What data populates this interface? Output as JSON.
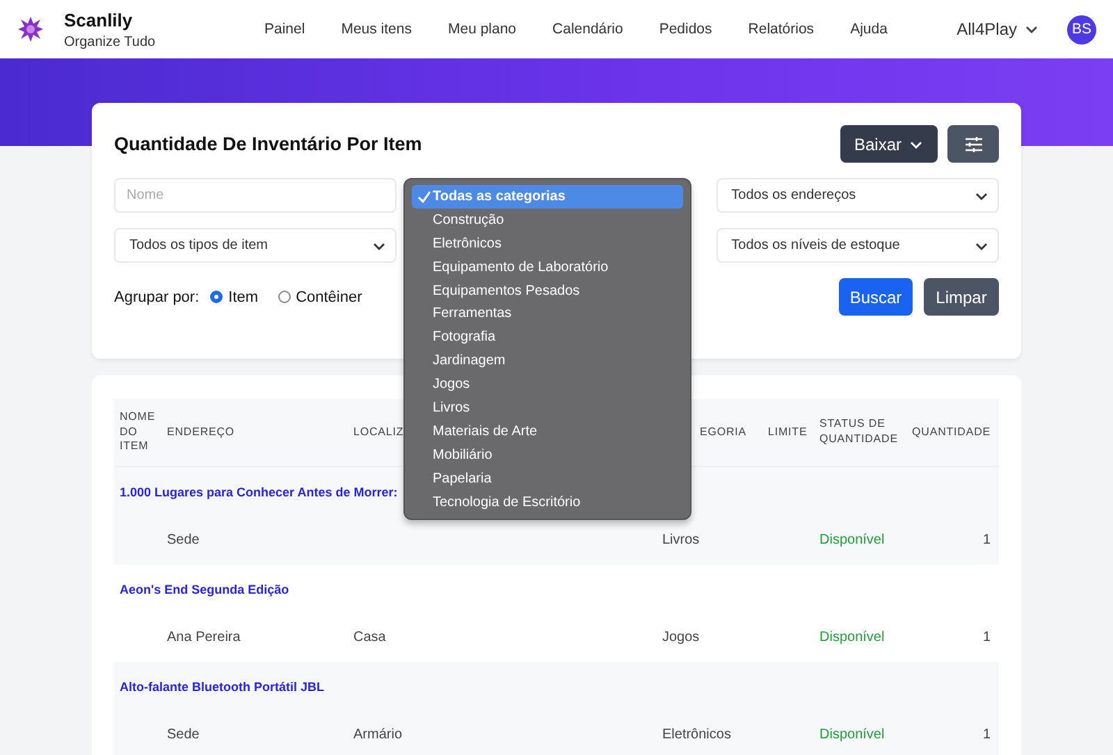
{
  "topbar": {
    "brand": "Scanlily",
    "tagline": "Organize Tudo",
    "nav": [
      {
        "label": "Painel"
      },
      {
        "label": "Meus itens"
      },
      {
        "label": "Meu plano"
      },
      {
        "label": "Calendário"
      },
      {
        "label": "Pedidos"
      },
      {
        "label": "Relatórios"
      },
      {
        "label": "Ajuda"
      }
    ],
    "account": "All4Play",
    "avatar": "BS"
  },
  "report": {
    "title": "Quantidade De Inventário Por Item",
    "download_button": "Baixar",
    "filters": [
      {
        "kind": "input",
        "placeholder": "Nome"
      },
      {
        "kind": "hidden"
      },
      {
        "kind": "select",
        "value": "Todos os endereços"
      },
      {
        "kind": "select",
        "value": "Todos os tipos de item"
      },
      {
        "kind": "hidden"
      },
      {
        "kind": "select",
        "value": "Todos os níveis de estoque"
      }
    ],
    "group_by": {
      "label": "Agrupar por:",
      "options": [
        {
          "label": "Item",
          "selected": true
        },
        {
          "label": "Contêiner",
          "selected": false
        }
      ]
    },
    "search_button": "Buscar",
    "clear_button": "Limpar"
  },
  "category_menu": {
    "options": [
      {
        "label": "Todas as categorias",
        "selected": true
      },
      {
        "label": "Construção",
        "selected": false
      },
      {
        "label": "Eletrônicos",
        "selected": false
      },
      {
        "label": "Equipamento de Laboratório",
        "selected": false
      },
      {
        "label": "Equipamentos Pesados",
        "selected": false
      },
      {
        "label": "Ferramentas",
        "selected": false
      },
      {
        "label": "Fotografia",
        "selected": false
      },
      {
        "label": "Jardinagem",
        "selected": false
      },
      {
        "label": "Jogos",
        "selected": false
      },
      {
        "label": "Livros",
        "selected": false
      },
      {
        "label": "Materiais de Arte",
        "selected": false
      },
      {
        "label": "Mobiliário",
        "selected": false
      },
      {
        "label": "Papelaria",
        "selected": false
      },
      {
        "label": "Tecnologia de Escritório",
        "selected": false
      }
    ]
  },
  "table": {
    "columns": [
      "NOME DO ITEM",
      "ENDEREÇO",
      "LOCALIZ",
      "EGORIA",
      "LIMITE",
      "STATUS DE QUANTIDADE",
      "QUANTIDADE"
    ],
    "groups": [
      {
        "name": "1.000 Lugares para Conhecer Antes de Morrer:",
        "rows": [
          {
            "address": "Sede",
            "location": "",
            "category": "Livros",
            "status": "Disponível",
            "quantity": "1"
          }
        ]
      },
      {
        "name": "Aeon's End Segunda Edição",
        "rows": [
          {
            "address": "Ana Pereira",
            "location": "Casa",
            "category": "Jogos",
            "status": "Disponível",
            "quantity": "1"
          }
        ]
      },
      {
        "name": "Alto-falante Bluetooth Portátil JBL",
        "rows": [
          {
            "address": "Sede",
            "location": "Armário",
            "category": "Eletrônicos",
            "status": "Disponível",
            "quantity": "1"
          }
        ]
      }
    ]
  }
}
